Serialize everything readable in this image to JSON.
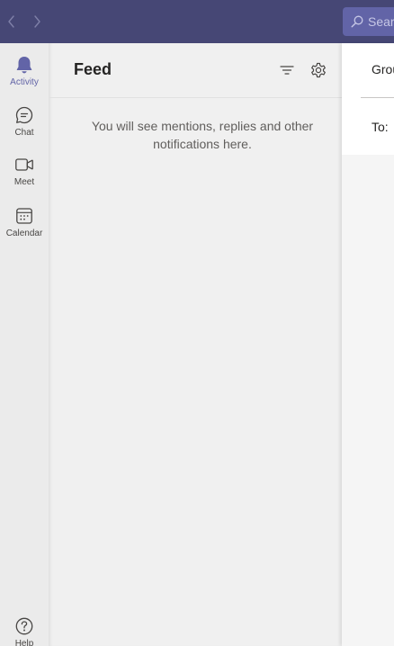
{
  "topbar": {
    "back_icon": "chevron-left-icon",
    "forward_icon": "chevron-right-icon",
    "search": {
      "placeholder": "Search",
      "icon": "search-icon"
    },
    "colors": {
      "background": "#464775",
      "search_background": "#6264a7"
    }
  },
  "rail": {
    "items": [
      {
        "label": "Activity",
        "icon": "bell-icon",
        "active": true
      },
      {
        "label": "Chat",
        "icon": "chat-icon",
        "active": false
      },
      {
        "label": "Meet",
        "icon": "video-camera-icon",
        "active": false
      },
      {
        "label": "Calendar",
        "icon": "calendar-icon",
        "active": false
      }
    ],
    "help": {
      "label": "Help",
      "icon": "help-icon"
    },
    "accent": "#6264a7"
  },
  "feed": {
    "title": "Feed",
    "filter_icon": "filter-icon",
    "settings_icon": "gear-icon",
    "empty_message": "You will see mentions, replies and other notifications here."
  },
  "compose": {
    "group_label": "Grou",
    "to_label": "To:"
  }
}
